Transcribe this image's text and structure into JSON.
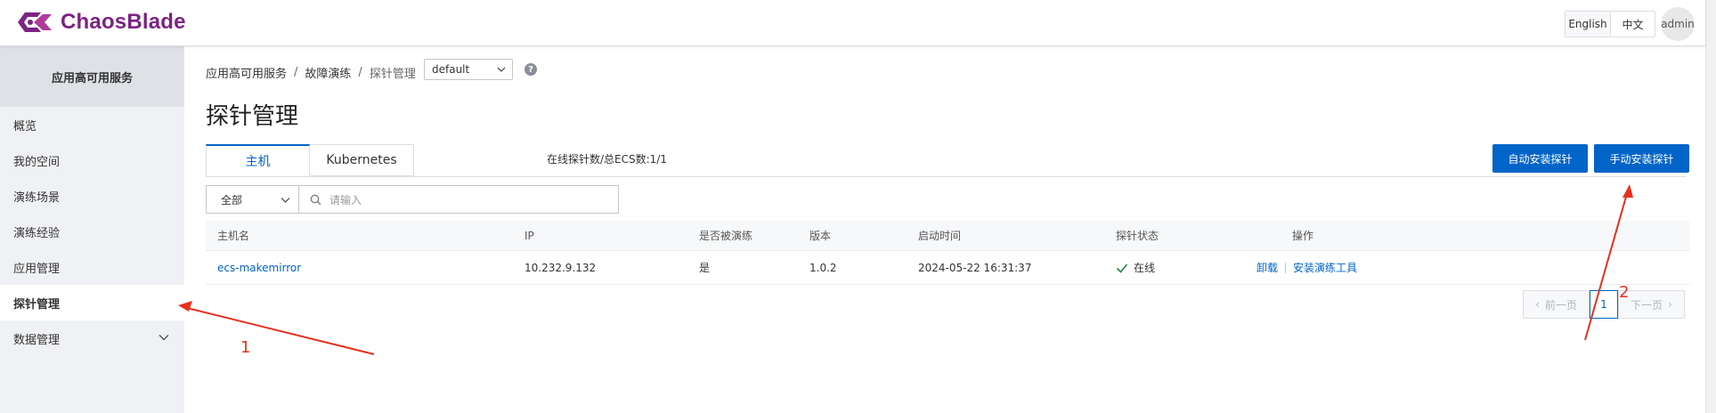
{
  "app": {
    "name": "ChaosBlade",
    "brand_color": "#7c2385",
    "accent_color": "#0064c8"
  },
  "header": {
    "lang_english": "English",
    "lang_chinese": "中文",
    "user": "admin"
  },
  "sidebar": {
    "title": "应用高可用服务",
    "items": [
      {
        "label": "概览"
      },
      {
        "label": "我的空间"
      },
      {
        "label": "演练场景"
      },
      {
        "label": "演练经验"
      },
      {
        "label": "应用管理"
      },
      {
        "label": "探针管理",
        "active": true
      },
      {
        "label": "数据管理",
        "expandable": true,
        "icon": "chevron-down-icon"
      }
    ]
  },
  "breadcrumb": [
    "应用高可用服务",
    "故障演练",
    "探针管理"
  ],
  "breadcrumb_separator": "/",
  "namespace": {
    "value": "default",
    "icon": "chevron-down-icon"
  },
  "help_icon": "?",
  "page_title": "探针管理",
  "tabs": [
    {
      "label": "主机",
      "active": true
    },
    {
      "label": "Kubernetes"
    }
  ],
  "probe_count": "在线探针数/总ECS数:1/1",
  "buttons": {
    "auto_install": "自动安装探针",
    "manual_install": "手动安装探针"
  },
  "filter": {
    "value": "全部"
  },
  "search": {
    "placeholder": "请输入",
    "icon": "search-icon"
  },
  "table": {
    "columns": [
      "主机名",
      "IP",
      "是否被演练",
      "版本",
      "启动时间",
      "探针状态",
      "操作"
    ],
    "rows": [
      {
        "hostname": "ecs-makemirror",
        "ip": "10.232.9.132",
        "drilled": "是",
        "version": "1.0.2",
        "start_time": "2024-05-22 16:31:37",
        "status": "在线",
        "status_icon": "check-icon",
        "actions": [
          "卸载",
          "安装演练工具"
        ]
      }
    ]
  },
  "pagination": {
    "prev": "前一页",
    "current": "1",
    "next": "下一页"
  },
  "annotations": {
    "color": "#e8301c",
    "label_1": "1",
    "label_2": "2"
  }
}
